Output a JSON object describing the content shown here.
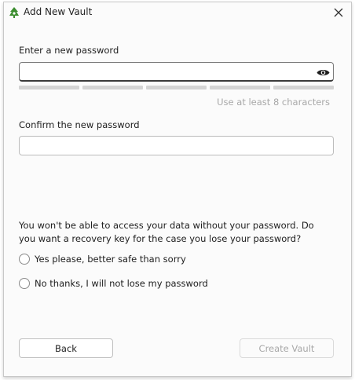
{
  "window": {
    "title": "Add New Vault",
    "icon": "cryptomator-icon",
    "close_icon": "close-icon"
  },
  "password": {
    "label": "Enter a new password",
    "value": "",
    "reveal_icon": "eye-icon",
    "strength_segments": 5,
    "hint": "Use at least 8 characters"
  },
  "confirm": {
    "label": "Confirm the new password",
    "value": ""
  },
  "recovery": {
    "question": "You won't be able to access your data without your password. Do you want a recovery key for the case you lose your password?",
    "options": [
      {
        "label": "Yes please, better safe than sorry",
        "selected": false
      },
      {
        "label": "No thanks, I will not lose my password",
        "selected": false
      }
    ]
  },
  "buttons": {
    "back": "Back",
    "create": "Create Vault",
    "create_enabled": false
  },
  "colors": {
    "accent": "#3c8d2f",
    "disabled_text": "#a8a8a8",
    "strength_empty": "#d4d4d4"
  }
}
